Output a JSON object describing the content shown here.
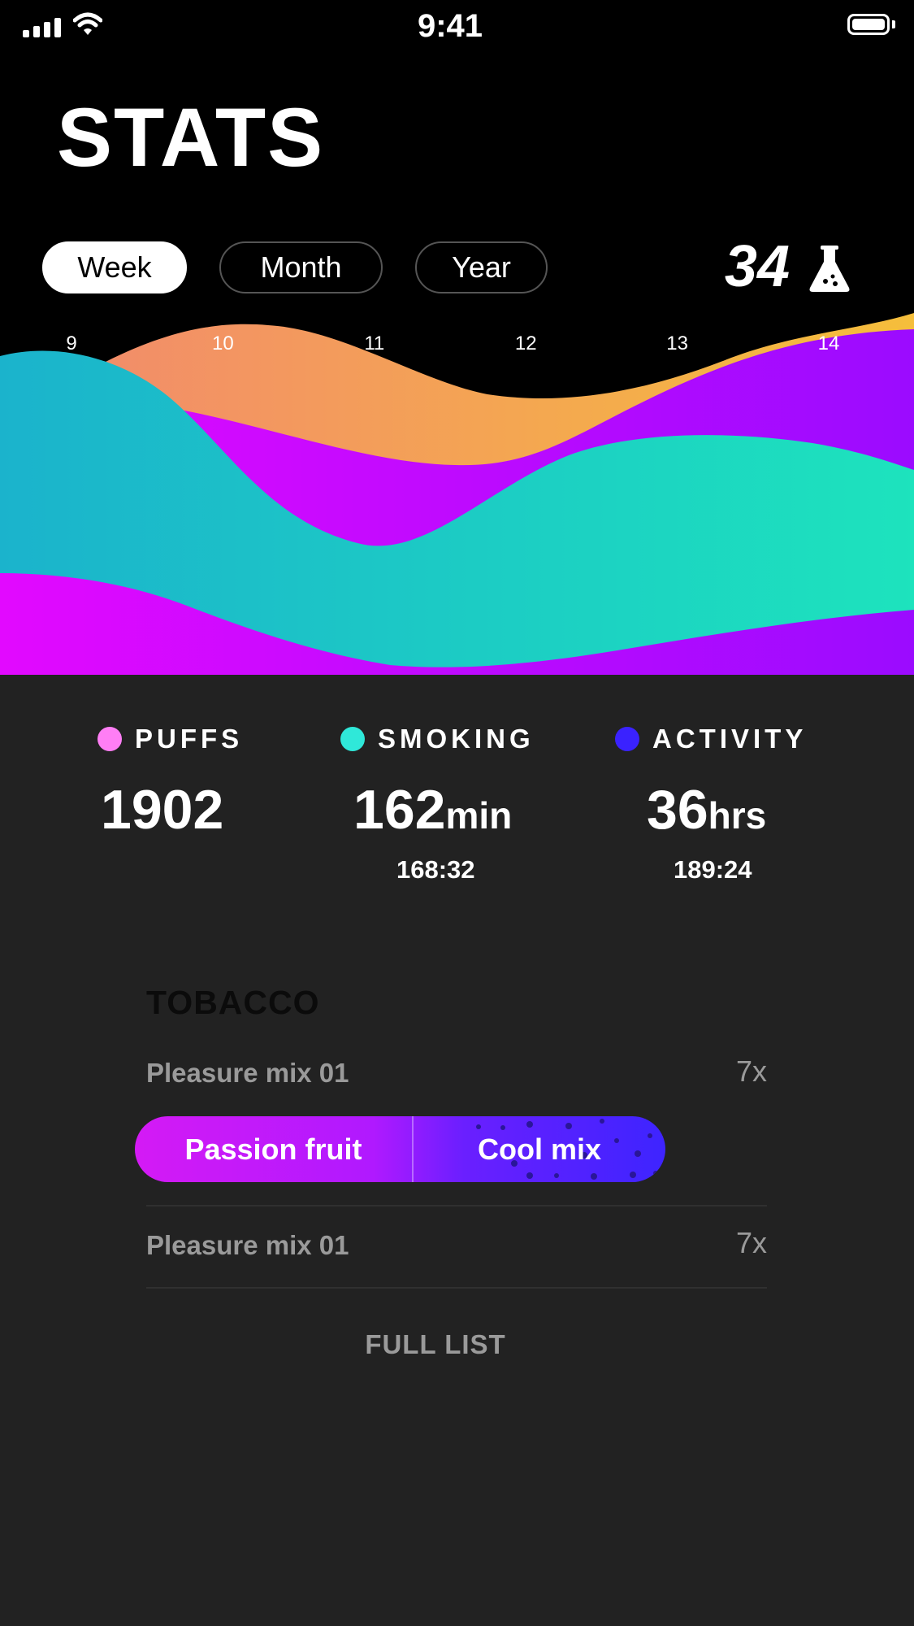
{
  "status_bar": {
    "time": "9:41",
    "signal_icon": "cellular-signal-icon",
    "wifi_icon": "wifi-icon",
    "battery_icon": "battery-icon"
  },
  "page": {
    "title": "STATS"
  },
  "period_tabs": {
    "items": [
      {
        "label": "Week",
        "active": true
      },
      {
        "label": "Month",
        "active": false
      },
      {
        "label": "Year",
        "active": false
      }
    ]
  },
  "count_badge": {
    "value": "34",
    "icon": "flask-icon"
  },
  "chart_data": {
    "type": "area",
    "x": [
      "9",
      "10",
      "11",
      "12",
      "13",
      "14"
    ],
    "series": [
      {
        "color": "#f39a6b"
      },
      {
        "color": "#c60bff"
      },
      {
        "color": "#1fc9c9"
      }
    ]
  },
  "stats": [
    {
      "label": "PUFFS",
      "value": "1902",
      "unit": "",
      "sub": "",
      "color": "#ff7ef5"
    },
    {
      "label": "SMOKING",
      "value": "162",
      "unit": "min",
      "sub": "168:32",
      "color": "#2fe8d9"
    },
    {
      "label": "ACTIVITY",
      "value": "36",
      "unit": "hrs",
      "sub": "189:24",
      "color": "#3a22ff"
    }
  ],
  "tobacco": {
    "title": "TOBACCO",
    "items": [
      {
        "name": "Pleasure mix 01",
        "count": "7x"
      },
      {
        "name": "Pleasure mix 01",
        "count": "7x"
      }
    ],
    "flavor_pill": {
      "left": "Passion fruit",
      "right": "Cool mix"
    },
    "full_list_label": "FULL LIST"
  }
}
